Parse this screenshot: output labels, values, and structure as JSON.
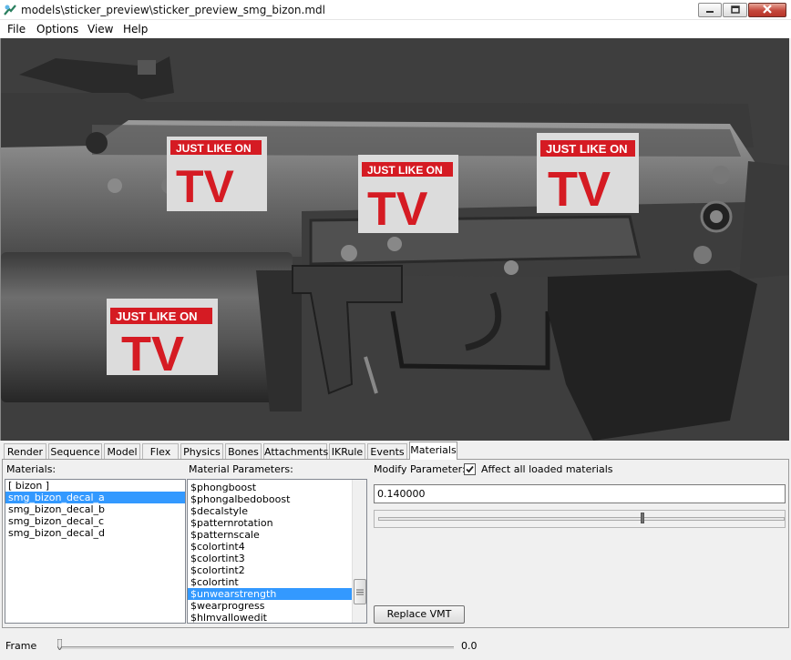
{
  "window": {
    "title": "models\\sticker_preview\\sticker_preview_smg_bizon.mdl"
  },
  "menu": [
    "File",
    "Options",
    "View",
    "Help"
  ],
  "viewport": {
    "sticker_text_top": "JUST LIKE ON",
    "sticker_text_big": "TV",
    "sticker_color": "#d51b23"
  },
  "tabs": [
    "Render",
    "Sequence",
    "Model",
    "Flex",
    "Physics",
    "Bones",
    "Attachments",
    "IKRule",
    "Events",
    "Materials"
  ],
  "active_tab": "Materials",
  "materials": {
    "label": "Materials:",
    "items": [
      "[ bizon ]",
      "smg_bizon_decal_a",
      "smg_bizon_decal_b",
      "smg_bizon_decal_c",
      "smg_bizon_decal_d"
    ],
    "selected": "smg_bizon_decal_a"
  },
  "params": {
    "label": "Material Parameters:",
    "items": [
      "$phongboost",
      "$phongalbedoboost",
      "$decalstyle",
      "$patternrotation",
      "$patternscale",
      "$colortint4",
      "$colortint3",
      "$colortint2",
      "$colortint",
      "$unwearstrength",
      "$wearprogress",
      "$hlmvallowedit"
    ],
    "selected": "$unwearstrength"
  },
  "modify": {
    "label": "Modify Parameter:",
    "checkbox_label": "Affect all loaded materials",
    "checked": true,
    "value": "0.140000",
    "slider_level": 0.65,
    "replace_button": "Replace VMT"
  },
  "frame": {
    "label": "Frame",
    "value": "0.0"
  },
  "colors": {
    "selection": "#3399ff",
    "viewport_bg": "#3e3e3e"
  }
}
